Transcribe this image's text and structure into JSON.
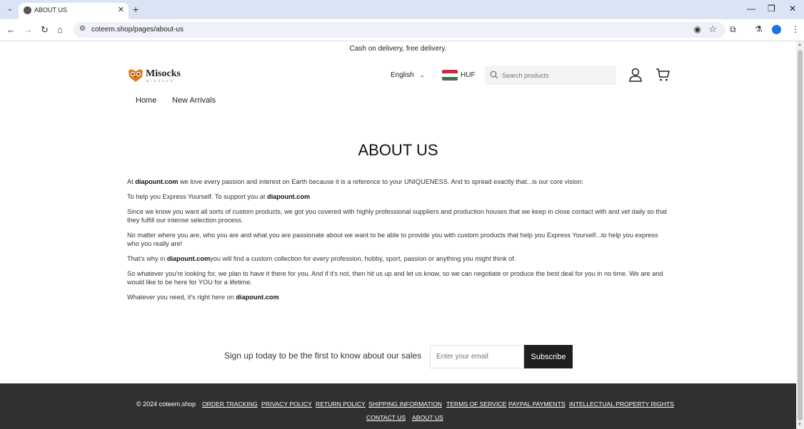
{
  "browser": {
    "tab_title": "ABOUT US",
    "url": "coteem.shop/pages/about-us"
  },
  "announcement": "Cash on delivery, free delivery.",
  "header": {
    "logo_text": "Misocks",
    "logo_subtext": "MISOCKS",
    "language": "English",
    "currency": "HUF",
    "search_placeholder": "Search products",
    "flag_colors": [
      "#cd2a3e",
      "#ffffff",
      "#436f4d"
    ]
  },
  "nav": {
    "items": [
      "Home",
      "New Arrivals"
    ]
  },
  "page": {
    "title": "ABOUT US",
    "paragraphs": [
      {
        "before": "At ",
        "bold": "diapount.com",
        "after": " we love every passion and interest on Earth because it is a reference to your UNIQUENESS. And to spread exactly that...is our core vision:"
      },
      {
        "before": "To help you Express Yourself. To support you at ",
        "bold": "diapount.com",
        "after": ""
      },
      {
        "before": "Since we know you want all sorts of custom products, we got you covered with highly professional suppliers and production houses that we keep in close contact with and vet daily so that they fulfill our intense selection process.",
        "bold": "",
        "after": ""
      },
      {
        "before": "No matter where you are, who you are and what you are passionate about we want to be able to provide you with custom products that help you Express Yourself...to help you express who you really are!",
        "bold": "",
        "after": ""
      },
      {
        "before": "That's why in ",
        "bold": "diapount.com",
        "after": "you will find a custom collection for every profession, hobby, sport, passion or anything you might think of."
      },
      {
        "before": "So whatever you're looking for, we plan to have it there for you. And if it's not, then hit us up and let us know, so we can negotiate or produce the best deal for you in no time. We are and would like to be here for YOU for a lifetime.",
        "bold": "",
        "after": ""
      },
      {
        "before": "Whatever you need, it's right here on ",
        "bold": "diapount.com",
        "after": ""
      }
    ]
  },
  "newsletter": {
    "text": "Sign up today to be the first to know about our sales",
    "email_placeholder": "Enter your email",
    "button_label": "Subscribe"
  },
  "footer": {
    "copyright": "© 2024 coteem.shop",
    "links": [
      "ORDER TRACKING",
      "PRIVACY POLICY",
      "RETURN POLICY",
      "SHIPPING INFORMATION",
      "TERMS OF SERVICE",
      "PAYPAL PAYMENTS",
      "INTELLECTUAL PROPERTY RIGHTS",
      "CONTACT US",
      "ABOUT US"
    ]
  }
}
